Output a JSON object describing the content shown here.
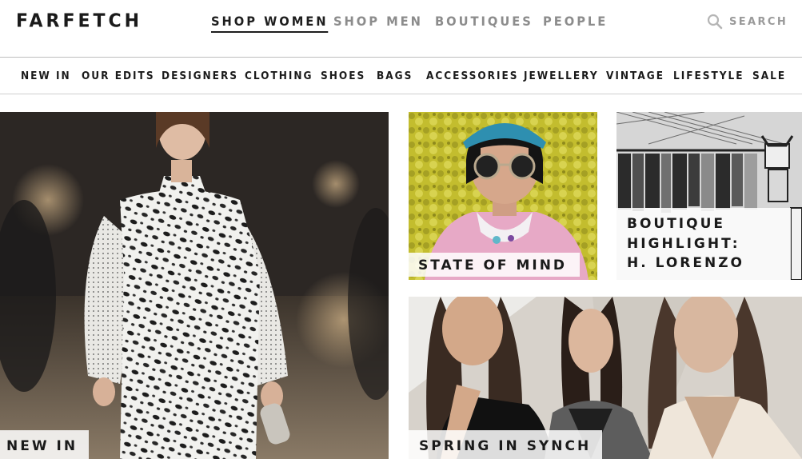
{
  "brand": {
    "logo_text": "FARFETCH"
  },
  "main_nav": {
    "items": [
      {
        "label": "SHOP WOMEN",
        "active": true
      },
      {
        "label": "SHOP MEN",
        "active": false
      },
      {
        "label": "BOUTIQUES",
        "active": false
      },
      {
        "label": "PEOPLE",
        "active": false
      }
    ]
  },
  "search": {
    "label": "SEARCH",
    "icon": "search-icon"
  },
  "categories": [
    "NEW IN",
    "OUR EDITS",
    "DESIGNERS",
    "CLOTHING",
    "SHOES",
    "BAGS",
    "ACCESSORIES",
    "JEWELLERY",
    "VINTAGE",
    "LIFESTYLE",
    "SALE"
  ],
  "tiles": {
    "hero": {
      "caption": "NEW IN"
    },
    "state_of_mind": {
      "caption": "STATE OF MIND"
    },
    "boutique": {
      "caption": "BOUTIQUE\nHIGHLIGHT:\nH. LORENZO"
    },
    "spring": {
      "caption": "SPRING IN SYNCH"
    }
  },
  "colors": {
    "text": "#1a1a1a",
    "muted_nav": "#8c8c8c",
    "border": "#cfcfcf"
  }
}
